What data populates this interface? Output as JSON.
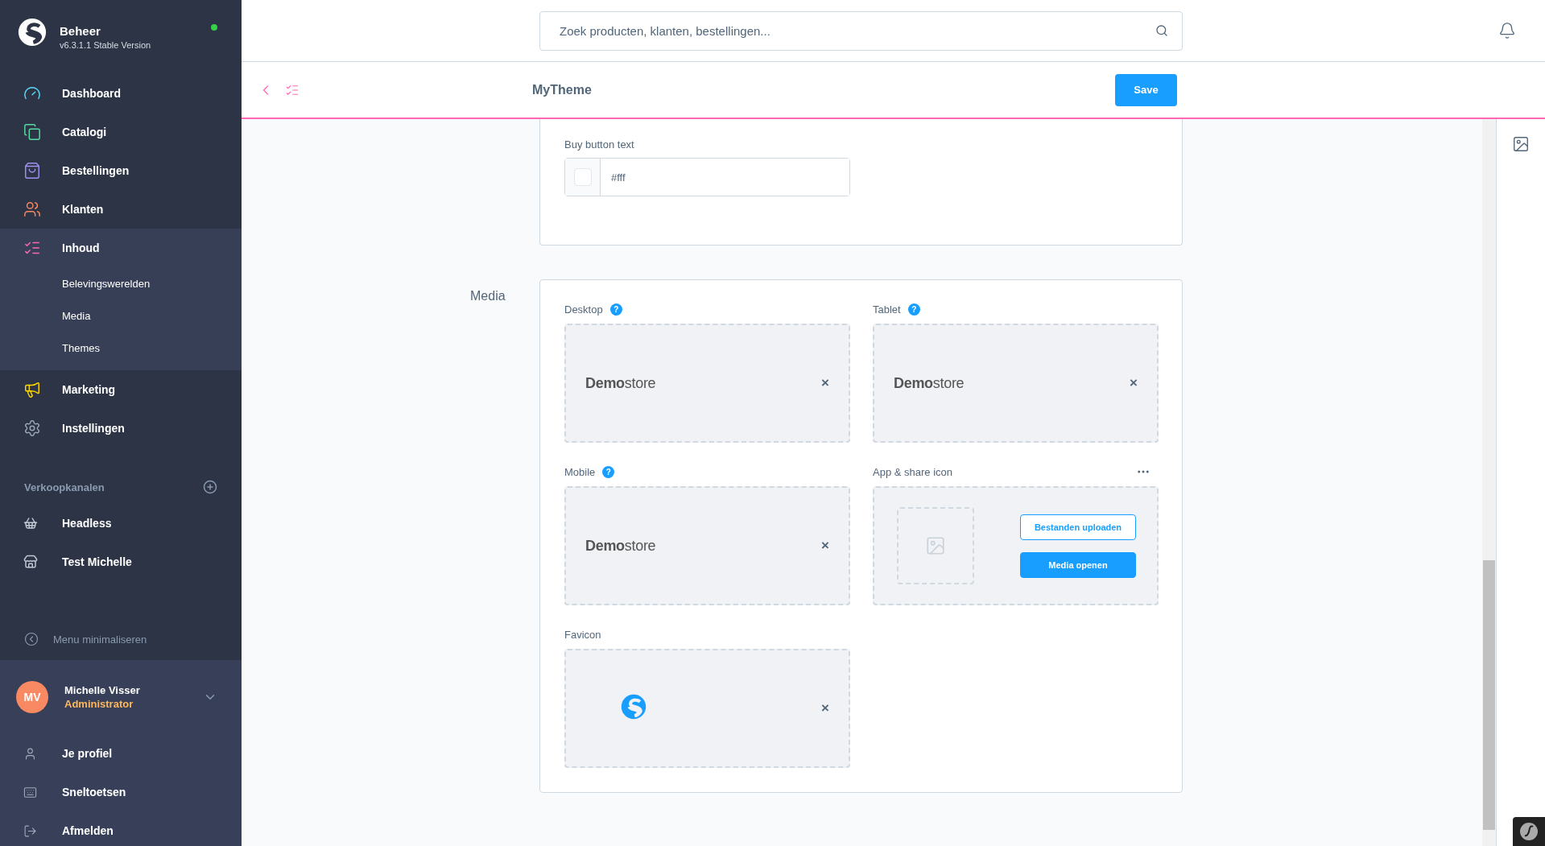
{
  "sidebar": {
    "brand": {
      "title": "Beheer",
      "version": "v6.3.1.1 Stable Version",
      "online": true
    },
    "menu": [
      {
        "label": "Dashboard",
        "color": "#57d9f7"
      },
      {
        "label": "Catalogi",
        "color": "#57d9a3"
      },
      {
        "label": "Bestellingen",
        "color": "#a092f0"
      },
      {
        "label": "Klanten",
        "color": "#f88962"
      },
      {
        "label": "Inhoud",
        "color": "#ff68b4",
        "expanded": true,
        "children": [
          {
            "label": "Belevingswerelden"
          },
          {
            "label": "Media"
          },
          {
            "label": "Themes"
          }
        ]
      },
      {
        "label": "Marketing",
        "color": "#ffd700"
      },
      {
        "label": "Instellingen",
        "color": "#9aa8b5"
      }
    ],
    "sales_channels": {
      "title": "Verkoopkanalen",
      "items": [
        {
          "label": "Headless"
        },
        {
          "label": "Test Michelle"
        }
      ]
    },
    "collapse": "Menu minimaliseren",
    "user": {
      "initials": "MV",
      "name": "Michelle Visser",
      "role": "Administrator"
    },
    "user_menu": [
      {
        "label": "Je profiel"
      },
      {
        "label": "Sneltoetsen"
      },
      {
        "label": "Afmelden"
      }
    ]
  },
  "search": {
    "placeholder": "Zoek producten, klanten, bestellingen..."
  },
  "page": {
    "title": "MyTheme",
    "save": "Save"
  },
  "color_field": {
    "label": "Buy button text",
    "value": "#fff"
  },
  "media": {
    "title": "Media",
    "fields": [
      {
        "label": "Desktop",
        "help": "?",
        "kind": "logo",
        "logo": "**Demo**store",
        "remove": "×"
      },
      {
        "label": "Tablet",
        "help": "?",
        "kind": "logo",
        "logo": "**Demo**store",
        "remove": "×"
      },
      {
        "label": "Mobile",
        "help": "?",
        "kind": "logo",
        "logo": "**Demo**store",
        "remove": "×"
      },
      {
        "label": "App & share icon",
        "kind": "empty",
        "menu": true,
        "upload": "Bestanden uploaden",
        "open": "Media openen"
      },
      {
        "label": "Favicon",
        "kind": "favicon",
        "remove": "×"
      }
    ]
  }
}
